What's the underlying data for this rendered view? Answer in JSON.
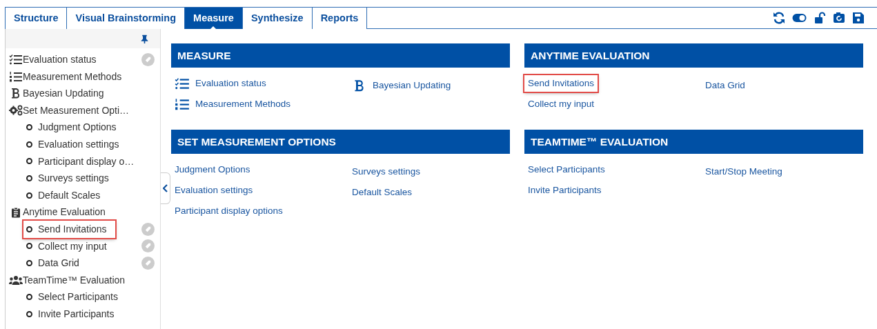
{
  "tabs": [
    {
      "label": "Structure",
      "selected": false
    },
    {
      "label": "Visual Brainstorming",
      "selected": false
    },
    {
      "label": "Measure",
      "selected": true
    },
    {
      "label": "Synthesize",
      "selected": false
    },
    {
      "label": "Reports",
      "selected": false
    }
  ],
  "sidebar": {
    "items": [
      {
        "label": "Evaluation status",
        "kind": "checklist",
        "tag": true,
        "highlighted": false
      },
      {
        "label": "Measurement Methods",
        "kind": "numbered-list",
        "tag": false,
        "highlighted": false
      },
      {
        "label": "Bayesian Updating",
        "kind": "bold-b",
        "tag": false,
        "highlighted": false
      },
      {
        "label": "Set Measurement Opti…",
        "kind": "gears",
        "tag": false,
        "highlighted": false,
        "children": [
          {
            "label": "Judgment Options",
            "tag": false,
            "highlighted": false
          },
          {
            "label": "Evaluation settings",
            "tag": false,
            "highlighted": false
          },
          {
            "label": "Participant display o…",
            "tag": false,
            "highlighted": false
          },
          {
            "label": "Surveys settings",
            "tag": false,
            "highlighted": false
          },
          {
            "label": "Default Scales",
            "tag": false,
            "highlighted": false
          }
        ]
      },
      {
        "label": "Anytime Evaluation",
        "kind": "clipboard",
        "tag": false,
        "highlighted": false,
        "children": [
          {
            "label": "Send Invitations",
            "tag": true,
            "highlighted": true
          },
          {
            "label": "Collect my input",
            "tag": true,
            "highlighted": false
          },
          {
            "label": "Data Grid",
            "tag": true,
            "highlighted": false
          }
        ]
      },
      {
        "label": "TeamTime™ Evaluation",
        "kind": "people",
        "tag": false,
        "highlighted": false,
        "children": [
          {
            "label": "Select Participants",
            "tag": false,
            "highlighted": false
          },
          {
            "label": "Invite Participants",
            "tag": false,
            "highlighted": false
          }
        ]
      }
    ]
  },
  "sections": [
    {
      "title": "MEASURE",
      "columns": [
        [
          {
            "label": "Evaluation status",
            "kind": "checklist",
            "highlighted": false
          },
          {
            "label": "Measurement Methods",
            "kind": "numbered-list",
            "highlighted": false
          }
        ],
        [
          {
            "label": "Bayesian Updating",
            "kind": "bold-b",
            "highlighted": false
          }
        ]
      ]
    },
    {
      "title": "ANYTIME EVALUATION",
      "columns": [
        [
          {
            "label": "Send Invitations",
            "highlighted": true
          },
          {
            "label": "Collect my input",
            "highlighted": false
          }
        ],
        [
          {
            "label": "Data Grid",
            "highlighted": false
          }
        ]
      ]
    },
    {
      "title": "SET MEASUREMENT OPTIONS",
      "columns": [
        [
          {
            "label": "Judgment Options",
            "highlighted": false
          },
          {
            "label": "Evaluation settings",
            "highlighted": false
          },
          {
            "label": "Participant display options",
            "highlighted": false
          }
        ],
        [
          {
            "label": "Surveys settings",
            "highlighted": false
          },
          {
            "label": "Default Scales",
            "highlighted": false
          }
        ]
      ]
    },
    {
      "title": "TEAMTIME™ EVALUATION",
      "columns": [
        [
          {
            "label": "Select Participants",
            "highlighted": false
          },
          {
            "label": "Invite Participants",
            "highlighted": false
          }
        ],
        [
          {
            "label": "Start/Stop Meeting",
            "highlighted": false
          }
        ]
      ]
    }
  ]
}
